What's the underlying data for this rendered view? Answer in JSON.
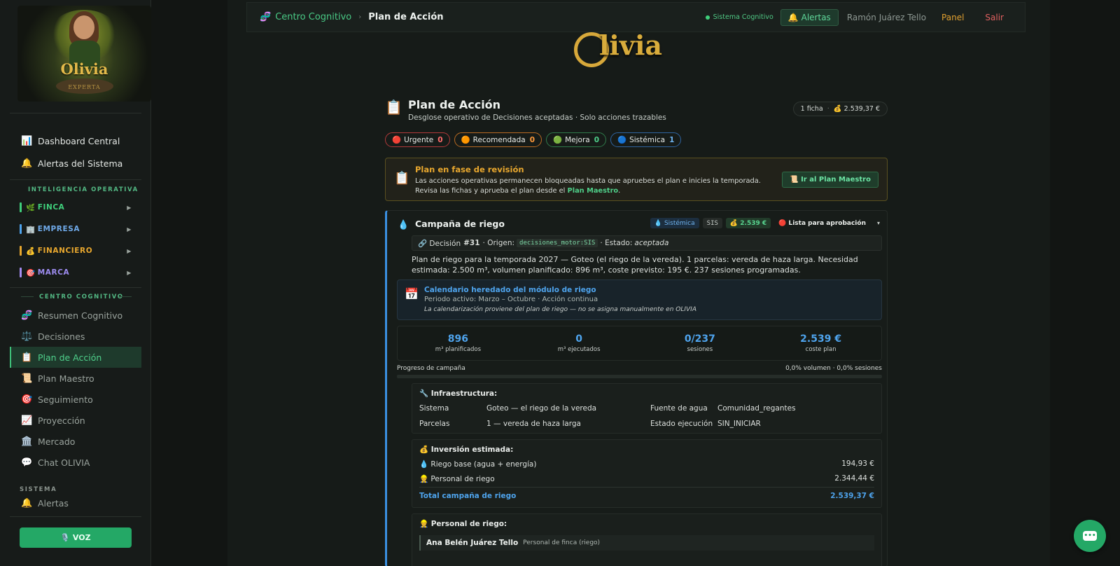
{
  "sidebar": {
    "logo": {
      "brand": "Olivia",
      "subtitle": "EXPERTA"
    },
    "nav_top": [
      {
        "icon": "📊",
        "label": "Dashboard Central"
      },
      {
        "icon": "🔔",
        "label": "Alertas del Sistema"
      }
    ],
    "section_operativa": "INTELIGENCIA OPERATIVA",
    "groups": [
      {
        "icon": "🌿",
        "label": "FINCA",
        "color": "#3fcf7b"
      },
      {
        "icon": "🏢",
        "label": "EMPRESA",
        "color": "#4ea3ec"
      },
      {
        "icon": "💰",
        "label": "FINANCIERO",
        "color": "#e8a72e"
      },
      {
        "icon": "🎯",
        "label": "MARCA",
        "color": "#a48cf0"
      }
    ],
    "section_cognitivo": "CENTRO COGNITIVO",
    "cognitivo_items": [
      {
        "icon": "🧬",
        "label": "Resumen Cognitivo"
      },
      {
        "icon": "⚖️",
        "label": "Decisiones"
      },
      {
        "icon": "📋",
        "label": "Plan de Acción"
      },
      {
        "icon": "📜",
        "label": "Plan Maestro"
      },
      {
        "icon": "🎯",
        "label": "Seguimiento"
      },
      {
        "icon": "📈",
        "label": "Proyección"
      },
      {
        "icon": "🏛️",
        "label": "Mercado"
      },
      {
        "icon": "💬",
        "label": "Chat OLIVIA"
      }
    ],
    "section_sistema": "SISTEMA",
    "sistema_partial": "Alertas",
    "voz_label": "🎙️ VOZ"
  },
  "topbar": {
    "crumb_icon": "🧬",
    "crumb_root": "Centro Cognitivo",
    "crumb_sep": "›",
    "crumb_current": "Plan de Acción",
    "status": "Sistema Cognitivo",
    "alerts": "🔔 Alertas",
    "user": "Ramón Juárez Tello",
    "panel": "Panel",
    "logout": "Salir"
  },
  "brand_logo": "livia",
  "page": {
    "icon": "📋",
    "title": "Plan de Acción",
    "subtitle": "Desglose operativo de Decisiones aceptadas · Solo acciones trazables",
    "fichas": "1 ficha",
    "total": "💰 2.539,37 €",
    "meta_sep": "·"
  },
  "filters": [
    {
      "icon": "🔴",
      "label": "Urgente",
      "count": "0",
      "border": "#b23a3a",
      "count_color": "#ff6b6b"
    },
    {
      "icon": "🟠",
      "label": "Recomendada",
      "count": "0",
      "border": "#b86a22",
      "count_color": "#ff9a3c"
    },
    {
      "icon": "🟢",
      "label": "Mejora",
      "count": "0",
      "border": "#2f7a4a",
      "count_color": "#4fd08b"
    },
    {
      "icon": "🔵",
      "label": "Sistémica",
      "count": "1",
      "border": "#2f64a0",
      "count_color": "#6fb3ee"
    }
  ],
  "review": {
    "icon": "📋",
    "title": "Plan en fase de revisión",
    "body": "Las acciones operativas permanecen bloqueadas hasta que apruebes el plan e inicies la temporada. Revisa las fichas y aprueba el plan desde el",
    "link": "Plan Maestro",
    "end": ".",
    "button": "📜 Ir al Plan Maestro"
  },
  "card": {
    "icon": "💧",
    "title": "Campaña de riego",
    "tag_type": "💧 Sistémica",
    "tag_code": "SIS",
    "tag_cost": "💰 2.539 €",
    "state": "🔴 Lista para aprobación",
    "caret": "▾",
    "decision": {
      "prefix": "🔗 Decisión",
      "id": "#31",
      "origin_label": "· Origen:",
      "origin": "decisiones_motor:SIS",
      "state_label": "· Estado:",
      "state": "aceptada"
    },
    "description": "Plan de riego para la temporada 2027 — Goteo (el riego de la vereda). 1 parcelas: vereda de haza larga. Necesidad estimada: 2.500 m³, volumen planificado: 896 m³, coste previsto: 195 €. 237 sesiones programadas.",
    "calendar": {
      "icon": "📅",
      "title": "Calendario heredado del módulo de riego",
      "period": "Periodo activo: Marzo – Octubre · Acción continua",
      "note": "La calendarización proviene del plan de riego — no se asigna manualmente en OLIVIA"
    },
    "stats": [
      {
        "value": "896",
        "label": "m³ planificados"
      },
      {
        "value": "0",
        "label": "m³ ejecutados"
      },
      {
        "value": "0/237",
        "label": "sesiones"
      },
      {
        "value": "2.539 €",
        "label": "coste plan"
      }
    ],
    "progress_label": "Progreso de campaña",
    "progress_text": "0,0% volumen · 0,0% sesiones",
    "progress_value": 0.0,
    "infra": {
      "title": "🔧 Infraestructura:",
      "sistema_k": "Sistema",
      "sistema_v": "Goteo — el riego de la vereda",
      "fuente_k": "Fuente de agua",
      "fuente_v": "Comunidad_regantes",
      "parcelas_k": "Parcelas",
      "parcelas_v": "1 — vereda de haza larga",
      "estado_k": "Estado ejecución",
      "estado_v": "SIN_INICIAR"
    },
    "investment": {
      "title": "💰 Inversión estimada:",
      "rows": [
        {
          "label": "💧 Riego base (agua + energía)",
          "amount": "194,93 €"
        },
        {
          "label": "👷 Personal de riego",
          "amount": "2.344,44 €"
        }
      ],
      "total_label": "Total campaña de riego",
      "total_amount": "2.539,37 €"
    },
    "personnel": {
      "title": "👷 Personal de riego:",
      "name": "Ana Belén Juárez Tello",
      "role": "Personal de finca (riego)"
    }
  },
  "chat_fab": "•••"
}
